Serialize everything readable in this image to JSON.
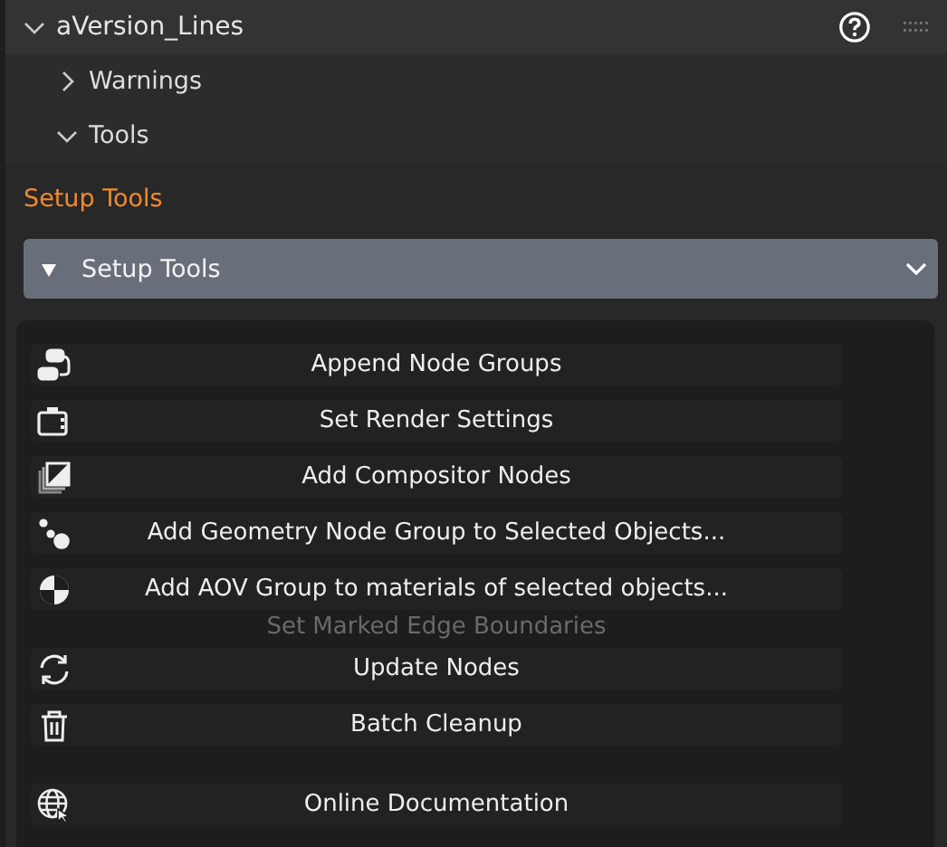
{
  "panel": {
    "title": "aVersion_Lines",
    "expanded": true
  },
  "subpanels": [
    {
      "label": "Warnings",
      "expanded": false
    },
    {
      "label": "Tools",
      "expanded": true
    }
  ],
  "section_label": "Setup Tools",
  "dropdown": {
    "value": "Setup Tools"
  },
  "menu": [
    {
      "kind": "item",
      "label": "Append Node Groups"
    },
    {
      "kind": "item",
      "label": "Set Render Settings"
    },
    {
      "kind": "item",
      "label": "Add Compositor Nodes"
    },
    {
      "kind": "item",
      "label": "Add Geometry Node Group to Selected Objects..."
    },
    {
      "kind": "item",
      "label": "Add AOV Group to materials of selected objects..."
    },
    {
      "kind": "behind",
      "label": "Set Marked Edge Boundaries"
    },
    {
      "kind": "item",
      "label": "Update Nodes"
    },
    {
      "kind": "item",
      "label": "Batch Cleanup"
    },
    {
      "kind": "gap"
    },
    {
      "kind": "item",
      "label": "Online Documentation"
    }
  ]
}
